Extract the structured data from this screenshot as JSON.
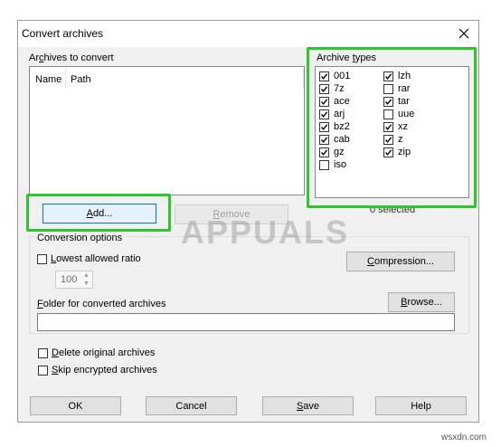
{
  "window": {
    "title": "Convert archives"
  },
  "left_panel": {
    "label_pre": "Ar",
    "label_u": "c",
    "label_post": "hives to convert",
    "columns": [
      "Name",
      "Path"
    ],
    "add_pre": "",
    "add_u": "A",
    "add_post": "dd...",
    "remove_pre": "",
    "remove_u": "R",
    "remove_post": "emove"
  },
  "archive_types": {
    "label_pre": "Archive ",
    "label_u": "t",
    "label_post": "ypes",
    "col1": [
      {
        "name": "001",
        "checked": true
      },
      {
        "name": "7z",
        "checked": true
      },
      {
        "name": "ace",
        "checked": true
      },
      {
        "name": "arj",
        "checked": true
      },
      {
        "name": "bz2",
        "checked": true
      },
      {
        "name": "cab",
        "checked": true
      },
      {
        "name": "gz",
        "checked": true
      },
      {
        "name": "iso",
        "checked": false
      }
    ],
    "col2": [
      {
        "name": "lzh",
        "checked": true
      },
      {
        "name": "rar",
        "checked": false
      },
      {
        "name": "tar",
        "checked": true
      },
      {
        "name": "uue",
        "checked": false
      },
      {
        "name": "xz",
        "checked": true
      },
      {
        "name": "z",
        "checked": true
      },
      {
        "name": "zip",
        "checked": true
      }
    ],
    "selected_status": "0 selected"
  },
  "conversion_options": {
    "label": "Conversion options",
    "lowest_ratio_pre": "",
    "lowest_ratio_u": "L",
    "lowest_ratio_post": "owest allowed ratio",
    "lowest_ratio_checked": false,
    "ratio_value": "100",
    "compression_pre": "",
    "compression_u": "C",
    "compression_post": "ompression..."
  },
  "folder": {
    "label_pre": "",
    "label_u": "F",
    "label_post": "older for converted archives",
    "browse_pre": "",
    "browse_u": "B",
    "browse_post": "rowse...",
    "value": ""
  },
  "options": {
    "delete_pre": "",
    "delete_u": "D",
    "delete_post": "elete original archives",
    "delete_checked": false,
    "skip_pre": "",
    "skip_u": "S",
    "skip_post": "kip encrypted archives",
    "skip_checked": false
  },
  "footer": {
    "ok": "OK",
    "cancel": "Cancel",
    "save_pre": "",
    "save_u": "S",
    "save_post": "ave",
    "help": "Help"
  },
  "watermark": {
    "text": "APPUALS",
    "site": "wsxdn.com"
  },
  "colors": {
    "highlight": "#2ec52e",
    "focus_blue": "#0078d7"
  }
}
